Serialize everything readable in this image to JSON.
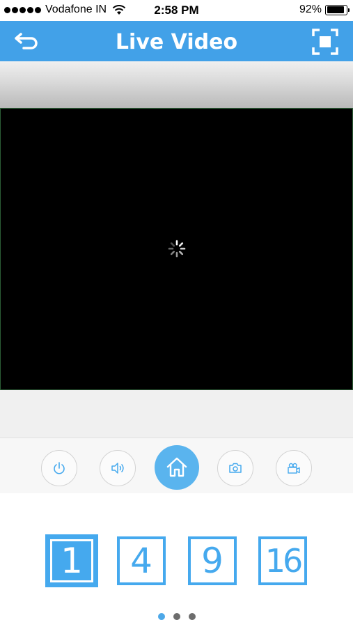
{
  "status_bar": {
    "carrier": "Vodafone IN",
    "time": "2:58 PM",
    "battery": "92%",
    "battery_level": 0.92
  },
  "nav": {
    "title": "Live Video",
    "back_icon": "back-arrow-icon",
    "fullscreen_icon": "fullscreen-icon"
  },
  "video": {
    "state": "loading",
    "loading_icon": "spinner-icon"
  },
  "toolbar": {
    "buttons": [
      {
        "icon": "power-icon"
      },
      {
        "icon": "speaker-icon"
      },
      {
        "icon": "home-icon"
      },
      {
        "icon": "camera-icon"
      },
      {
        "icon": "video-record-icon"
      }
    ],
    "accent": "#42a1e8"
  },
  "split_views": {
    "options": [
      "1",
      "4",
      "9",
      "16"
    ],
    "selected": "1"
  },
  "pager": {
    "pages": 3,
    "current": 1
  }
}
